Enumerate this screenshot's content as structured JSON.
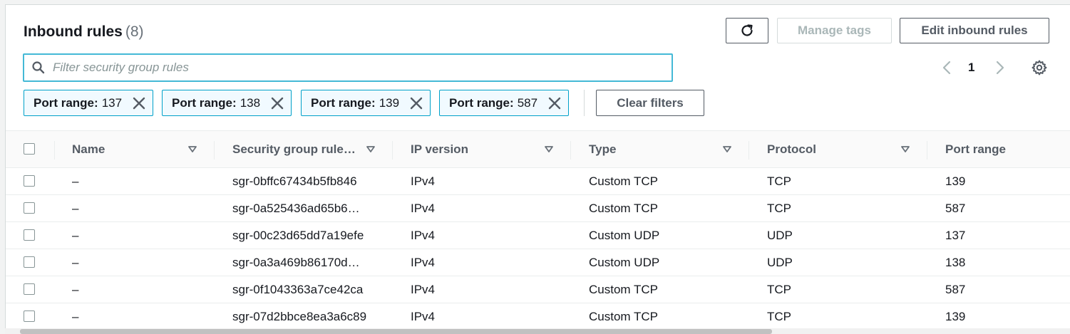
{
  "header": {
    "title": "Inbound rules",
    "count": "(8)",
    "manage_tags_label": "Manage tags",
    "edit_inbound_rules_label": "Edit inbound rules"
  },
  "search": {
    "placeholder": "Filter security group rules",
    "value": ""
  },
  "pagination": {
    "current_page": "1"
  },
  "filters": [
    {
      "key": "Port range:",
      "value": "137"
    },
    {
      "key": "Port range:",
      "value": "138"
    },
    {
      "key": "Port range:",
      "value": "139"
    },
    {
      "key": "Port range:",
      "value": "587"
    }
  ],
  "clear_filters_label": "Clear filters",
  "table": {
    "columns": [
      "Name",
      "Security group rule…",
      "IP version",
      "Type",
      "Protocol",
      "Port range"
    ],
    "rows": [
      {
        "name": "–",
        "rule_id": "sgr-0bffc67434b5fb846",
        "ip_version": "IPv4",
        "type": "Custom TCP",
        "protocol": "TCP",
        "port_range": "139"
      },
      {
        "name": "–",
        "rule_id": "sgr-0a525436ad65b6…",
        "ip_version": "IPv4",
        "type": "Custom TCP",
        "protocol": "TCP",
        "port_range": "587"
      },
      {
        "name": "–",
        "rule_id": "sgr-00c23d65dd7a19efe",
        "ip_version": "IPv4",
        "type": "Custom UDP",
        "protocol": "UDP",
        "port_range": "137"
      },
      {
        "name": "–",
        "rule_id": "sgr-0a3a469b86170d…",
        "ip_version": "IPv4",
        "type": "Custom UDP",
        "protocol": "UDP",
        "port_range": "138"
      },
      {
        "name": "–",
        "rule_id": "sgr-0f1043363a7ce42ca",
        "ip_version": "IPv4",
        "type": "Custom TCP",
        "protocol": "TCP",
        "port_range": "587"
      },
      {
        "name": "–",
        "rule_id": "sgr-07d2bbce8ea3a6c89",
        "ip_version": "IPv4",
        "type": "Custom TCP",
        "protocol": "TCP",
        "port_range": "139"
      }
    ]
  },
  "colors": {
    "accent": "#44b9d6",
    "chip_border": "#00a1c9",
    "chip_bg": "#f1faff",
    "text": "#16191f",
    "muted": "#687078"
  },
  "icons": {
    "refresh": "refresh-icon",
    "search": "search-icon",
    "prev": "chevron-left-icon",
    "next": "chevron-right-icon",
    "settings": "gear-icon",
    "remove_filter": "close-icon",
    "sort": "sort-down-icon"
  }
}
